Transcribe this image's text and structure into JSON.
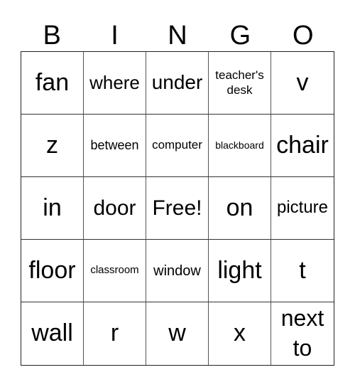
{
  "header": [
    "B",
    "I",
    "N",
    "G",
    "O"
  ],
  "cells": [
    [
      "fan",
      "where",
      "under",
      "teacher's desk",
      "v"
    ],
    [
      "z",
      "between",
      "computer",
      "blackboard",
      "chair"
    ],
    [
      "in",
      "door",
      "Free!",
      "on",
      "picture"
    ],
    [
      "floor",
      "classroom",
      "window",
      "light",
      "t"
    ],
    [
      "wall",
      "r",
      "w",
      "x",
      "next to"
    ]
  ]
}
